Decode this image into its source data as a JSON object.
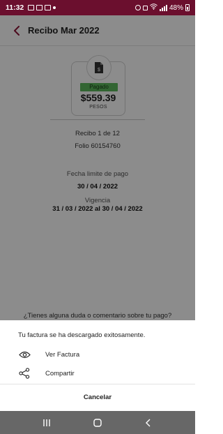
{
  "status_bar": {
    "time": "11:32",
    "battery": "48%"
  },
  "header": {
    "title": "Recibo Mar 2022"
  },
  "receipt": {
    "status": "Pagado",
    "amount": "$559.39",
    "currency": "PESOS",
    "receipt_index": "Recibo 1 de 12",
    "folio": "Folio 60154760",
    "due_label": "Fecha limite de pago",
    "due_date": "30 / 04 / 2022",
    "validity_label": "Vigencia",
    "validity_range": "31 / 03 / 2022 al 30 / 04 / 2022",
    "question": "¿Tienes alguna duda o comentario sobre tu pago?"
  },
  "sheet": {
    "message": "Tu factura se ha descargado exitosamente.",
    "actions": [
      {
        "label": "Ver Factura",
        "icon": "eye-icon"
      },
      {
        "label": "Compartir",
        "icon": "share-icon"
      }
    ],
    "cancel_label": "Cancelar"
  },
  "colors": {
    "brand": "#6b0f2e",
    "paid_badge": "#5cb85c"
  }
}
